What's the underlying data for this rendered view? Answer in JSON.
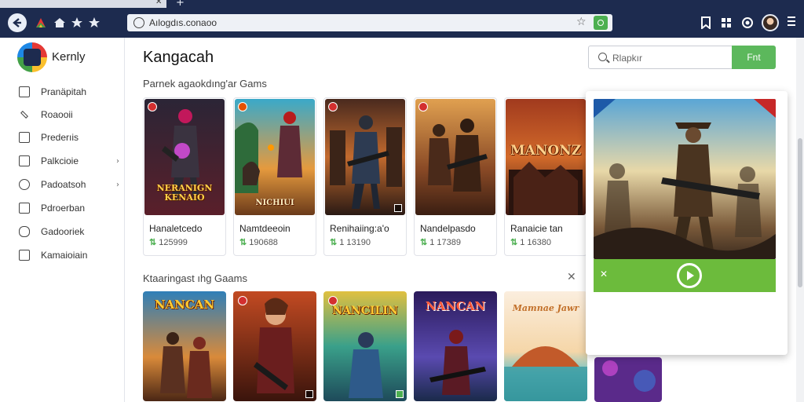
{
  "browser": {
    "url": "Aılogdıs.conaoo",
    "icons": [
      "back-arrow-icon",
      "extension-icon",
      "bookmark-star-icon",
      "bookmark-star-icon"
    ]
  },
  "sidebar": {
    "brand": "Kernly",
    "items": [
      {
        "label": "Pranäpitah",
        "icon": "mail-icon",
        "has_chevron": false
      },
      {
        "label": "Roaooii",
        "icon": "pen-icon",
        "has_chevron": false
      },
      {
        "label": "Prederıis",
        "icon": "document-icon",
        "has_chevron": false
      },
      {
        "label": "Palkcioie",
        "icon": "folder-icon",
        "has_chevron": true
      },
      {
        "label": "Padoatsoh",
        "icon": "gear-icon",
        "has_chevron": true
      },
      {
        "label": "Pdroerban",
        "icon": "calendar-icon",
        "has_chevron": false
      },
      {
        "label": "Gadooriek",
        "icon": "gamepad-icon",
        "has_chevron": false
      },
      {
        "label": "Kamaioiain",
        "icon": "image-icon",
        "has_chevron": false
      }
    ],
    "chevron": "›"
  },
  "main": {
    "title": "Kangacah",
    "search_placeholder": "Rlapkır",
    "search_button": "Fnt",
    "section1_title": "Parnek agaokdıng'ar Gams",
    "section2_title": "Ktaaringast ıhg Gaams",
    "close_label": "✕",
    "games_row1": [
      {
        "name": "Hanaletcedo",
        "downloads": "125999",
        "art_text": "NERANIGN\nKENAIO"
      },
      {
        "name": "Namtdeeoin",
        "downloads": "190688",
        "art_text": "NICHIUI"
      },
      {
        "name": "Renihaiing:a'o",
        "downloads": "1 13190",
        "art_text": ""
      },
      {
        "name": "Nandelpasdo",
        "downloads": "1 17389",
        "art_text": ""
      },
      {
        "name": "Ranaicie tan",
        "downloads": "1 16380",
        "art_text": "MANONZ"
      }
    ],
    "download_glyph": "⇅",
    "games_row2": [
      {
        "art_text": "NANCAN"
      },
      {
        "art_text": ""
      },
      {
        "art_text": "NANCILIN"
      },
      {
        "art_text": "NANCAN"
      },
      {
        "art_text": "Mamnae Jawr"
      }
    ]
  },
  "popup": {
    "close_label": "✕"
  }
}
